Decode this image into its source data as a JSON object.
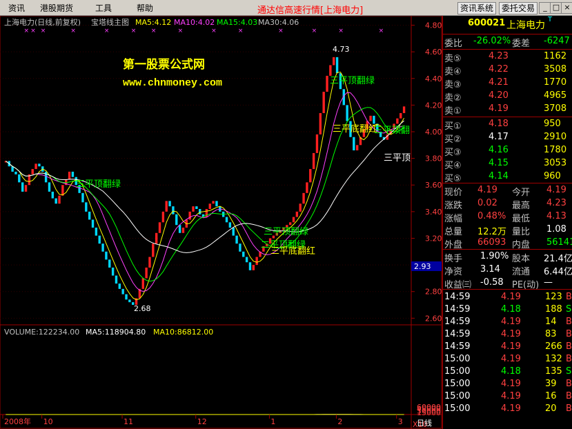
{
  "menu": {
    "items": [
      "资讯",
      "港股期货",
      "工具",
      "帮助"
    ],
    "title": "通达信高速行情[上海电力]",
    "btn_news": "资讯系统",
    "btn_trade": "委托交易",
    "win_min": "_",
    "win_max": "□",
    "win_close": "×"
  },
  "chart_header": {
    "name": "上海电力(日线,前复权)",
    "indicator": "宝塔线主图",
    "ma5": "MA5:4.12",
    "ma10": "MA10:4.02",
    "ma15": "MA15:4.03",
    "ma30": "MA30:4.06"
  },
  "watermark": {
    "line1": "第一股票公式网",
    "line2": "www.chnmoney.com"
  },
  "annotations": {
    "high": "4.73",
    "low": "2.68",
    "a1": "三平顶翻绿",
    "a2": "三平顶翻绿",
    "a3": "三平顶翻绿",
    "a4": "二平顶翻绿",
    "a5": "三平底翻红",
    "a6": "三平底翻红",
    "a7": "三平顶",
    "a8": "三平顶翻"
  },
  "price_axis": [
    "4.80",
    "4.60",
    "4.40",
    "4.20",
    "4.00",
    "3.80",
    "3.60",
    "3.40",
    "3.20",
    "3.00",
    "2.80",
    "2.60"
  ],
  "current_price_tag": "2.93",
  "volume_header": {
    "vol": "VOLUME:122234.00",
    "ma5": "MA5:118904.80",
    "ma10": "MA10:86812.00"
  },
  "volume_axis": [
    "60000",
    "45000",
    "30000",
    "15000",
    "X10"
  ],
  "time_axis": [
    "2008年",
    "10",
    "11",
    "12",
    "1",
    "2",
    "3"
  ],
  "period_label": "日线",
  "quote": {
    "code": "600021",
    "name": "上海电力",
    "flag": "T",
    "weibi_label": "委比",
    "weibi": "-26.02%",
    "weicha_label": "委差",
    "weicha": "-6247",
    "asks": [
      {
        "label": "卖⑤",
        "price": "4.23",
        "vol": "1162"
      },
      {
        "label": "卖④",
        "price": "4.22",
        "vol": "3508"
      },
      {
        "label": "卖③",
        "price": "4.21",
        "vol": "1770"
      },
      {
        "label": "卖②",
        "price": "4.20",
        "vol": "4965"
      },
      {
        "label": "卖①",
        "price": "4.19",
        "vol": "3708"
      }
    ],
    "bids": [
      {
        "label": "买①",
        "price": "4.18",
        "vol": "950"
      },
      {
        "label": "买②",
        "price": "4.17",
        "vol": "2910"
      },
      {
        "label": "买③",
        "price": "4.16",
        "vol": "1780"
      },
      {
        "label": "买④",
        "price": "4.15",
        "vol": "3053"
      },
      {
        "label": "买⑤",
        "price": "4.14",
        "vol": "960"
      }
    ],
    "stats": [
      {
        "l1": "现价",
        "v1": "4.19",
        "l2": "今开",
        "v2": "4.19"
      },
      {
        "l1": "涨跌",
        "v1": "0.02",
        "l2": "最高",
        "v2": "4.23"
      },
      {
        "l1": "涨幅",
        "v1": "0.48%",
        "l2": "最低",
        "v2": "4.13"
      },
      {
        "l1": "总量",
        "v1": "12.2万",
        "l2": "量比",
        "v2": "1.08"
      },
      {
        "l1": "外盘",
        "v1": "66093",
        "l2": "内盘",
        "v2": "56141"
      }
    ],
    "stats2": [
      {
        "l1": "换手",
        "v1": "1.90%",
        "l2": "股本",
        "v2": "21.4亿"
      },
      {
        "l1": "净资",
        "v1": "3.14",
        "l2": "流通",
        "v2": "6.44亿"
      },
      {
        "l1": "收益㈢",
        "v1": "-0.58",
        "l2": "PE(动)",
        "v2": "—"
      }
    ],
    "ticks": [
      {
        "t": "14:59",
        "p": "4.19",
        "v": "123",
        "d": "B"
      },
      {
        "t": "14:59",
        "p": "4.18",
        "v": "188",
        "d": "S"
      },
      {
        "t": "14:59",
        "p": "4.19",
        "v": "14",
        "d": "B"
      },
      {
        "t": "14:59",
        "p": "4.19",
        "v": "83",
        "d": "B"
      },
      {
        "t": "14:59",
        "p": "4.19",
        "v": "266",
        "d": "B"
      },
      {
        "t": "15:00",
        "p": "4.19",
        "v": "132",
        "d": "B"
      },
      {
        "t": "15:00",
        "p": "4.18",
        "v": "135",
        "d": "S"
      },
      {
        "t": "15:00",
        "p": "4.19",
        "v": "39",
        "d": "B"
      },
      {
        "t": "15:00",
        "p": "4.19",
        "v": "16",
        "d": "B"
      },
      {
        "t": "15:00",
        "p": "4.19",
        "v": "20",
        "d": "B"
      }
    ]
  },
  "chart_data": {
    "type": "line",
    "price_range": [
      2.55,
      4.87
    ],
    "volume_range": [
      0,
      64000
    ],
    "close": [
      3.78,
      3.74,
      3.7,
      3.68,
      3.62,
      3.55,
      3.6,
      3.68,
      3.72,
      3.76,
      3.74,
      3.7,
      3.62,
      3.55,
      3.5,
      3.46,
      3.52,
      3.6,
      3.64,
      3.7,
      3.66,
      3.6,
      3.54,
      3.47,
      3.4,
      3.34,
      3.28,
      3.22,
      3.16,
      3.1,
      3.04,
      2.98,
      2.92,
      2.86,
      2.82,
      2.78,
      2.74,
      2.72,
      2.7,
      2.75,
      2.82,
      2.9,
      2.98,
      3.06,
      3.16,
      3.24,
      3.32,
      3.4,
      3.48,
      3.44,
      3.38,
      3.3,
      3.24,
      3.28,
      3.34,
      3.4,
      3.44,
      3.42,
      3.38,
      3.36,
      3.42,
      3.46,
      3.48,
      3.44,
      3.4,
      3.36,
      3.32,
      3.28,
      3.22,
      3.16,
      3.1,
      3.06,
      3.02,
      2.96,
      3.0,
      3.06,
      3.1,
      3.14,
      3.16,
      3.2,
      3.22,
      3.24,
      3.26,
      3.28,
      3.3,
      3.32,
      3.36,
      3.4,
      3.46,
      3.54,
      3.62,
      3.72,
      3.84,
      3.98,
      4.14,
      4.3,
      4.42,
      4.5,
      4.56,
      4.44,
      4.32,
      4.2,
      4.08,
      3.96,
      3.86,
      3.9,
      3.96,
      4.02,
      4.08,
      4.12,
      4.06,
      4.0,
      3.96,
      3.94,
      3.98,
      4.02,
      4.06,
      4.1,
      4.14,
      4.19
    ],
    "volume": [
      9,
      8,
      7,
      8,
      6,
      7,
      9,
      10,
      8,
      7,
      6,
      8,
      7,
      6,
      5,
      6,
      7,
      8,
      9,
      8,
      7,
      6,
      5,
      6,
      7,
      6,
      5,
      5,
      6,
      7,
      8,
      7,
      6,
      5,
      6,
      7,
      8,
      9,
      10,
      12,
      11,
      10,
      9,
      8,
      10,
      12,
      11,
      10,
      9,
      8,
      7,
      8,
      9,
      10,
      9,
      8,
      7,
      6,
      7,
      8,
      9,
      10,
      9,
      8,
      7,
      6,
      5,
      6,
      7,
      8,
      7,
      6,
      5,
      6,
      7,
      8,
      9,
      10,
      11,
      12,
      13,
      14,
      15,
      16,
      17,
      18,
      16,
      17,
      19,
      21,
      24,
      28,
      32,
      38,
      45,
      52,
      60,
      48,
      40,
      34,
      30,
      28,
      26,
      24,
      22,
      20,
      19,
      18,
      17,
      16,
      15,
      14,
      13,
      12,
      11,
      12,
      13,
      12,
      11,
      12
    ],
    "volume_ma5": [
      9,
      9,
      9,
      8,
      8,
      8,
      8,
      8,
      8,
      8,
      8,
      8,
      7,
      7,
      7,
      6,
      6,
      7,
      7,
      8,
      8,
      7,
      7,
      7,
      6,
      6,
      6,
      6,
      6,
      6,
      6,
      7,
      7,
      7,
      6,
      6,
      7,
      7,
      8,
      9,
      10,
      10,
      11,
      10,
      10,
      10,
      10,
      10,
      10,
      10,
      9,
      9,
      9,
      9,
      9,
      9,
      9,
      8,
      8,
      8,
      8,
      8,
      8,
      8,
      8,
      8,
      7,
      7,
      7,
      7,
      7,
      7,
      6,
      6,
      6,
      7,
      7,
      8,
      8,
      9,
      10,
      11,
      12,
      13,
      14,
      15,
      16,
      16,
      17,
      18,
      19,
      21,
      24,
      28,
      33,
      39,
      45,
      49,
      49,
      47,
      42,
      37,
      32,
      28,
      26,
      24,
      22,
      21,
      19,
      18,
      17,
      16,
      15,
      14,
      13,
      13,
      13,
      12,
      12,
      12
    ],
    "volume_ma10": [
      9,
      9,
      9,
      9,
      9,
      9,
      8,
      8,
      8,
      8,
      8,
      8,
      8,
      8,
      8,
      7,
      7,
      7,
      7,
      7,
      7,
      7,
      7,
      7,
      7,
      7,
      7,
      7,
      7,
      7,
      7,
      7,
      7,
      7,
      7,
      7,
      7,
      7,
      7,
      8,
      8,
      8,
      9,
      9,
      9,
      9,
      10,
      10,
      10,
      10,
      10,
      10,
      10,
      10,
      10,
      10,
      9,
      9,
      9,
      9,
      9,
      9,
      9,
      9,
      8,
      8,
      8,
      8,
      8,
      8,
      8,
      8,
      7,
      7,
      7,
      7,
      7,
      7,
      7,
      8,
      8,
      9,
      10,
      10,
      11,
      12,
      13,
      14,
      15,
      16,
      17,
      18,
      20,
      22,
      25,
      28,
      33,
      36,
      38,
      40,
      40,
      40,
      39,
      37,
      34,
      31,
      28,
      26,
      24,
      22,
      21,
      19,
      18,
      17,
      17,
      16,
      15,
      15,
      14,
      14
    ]
  }
}
